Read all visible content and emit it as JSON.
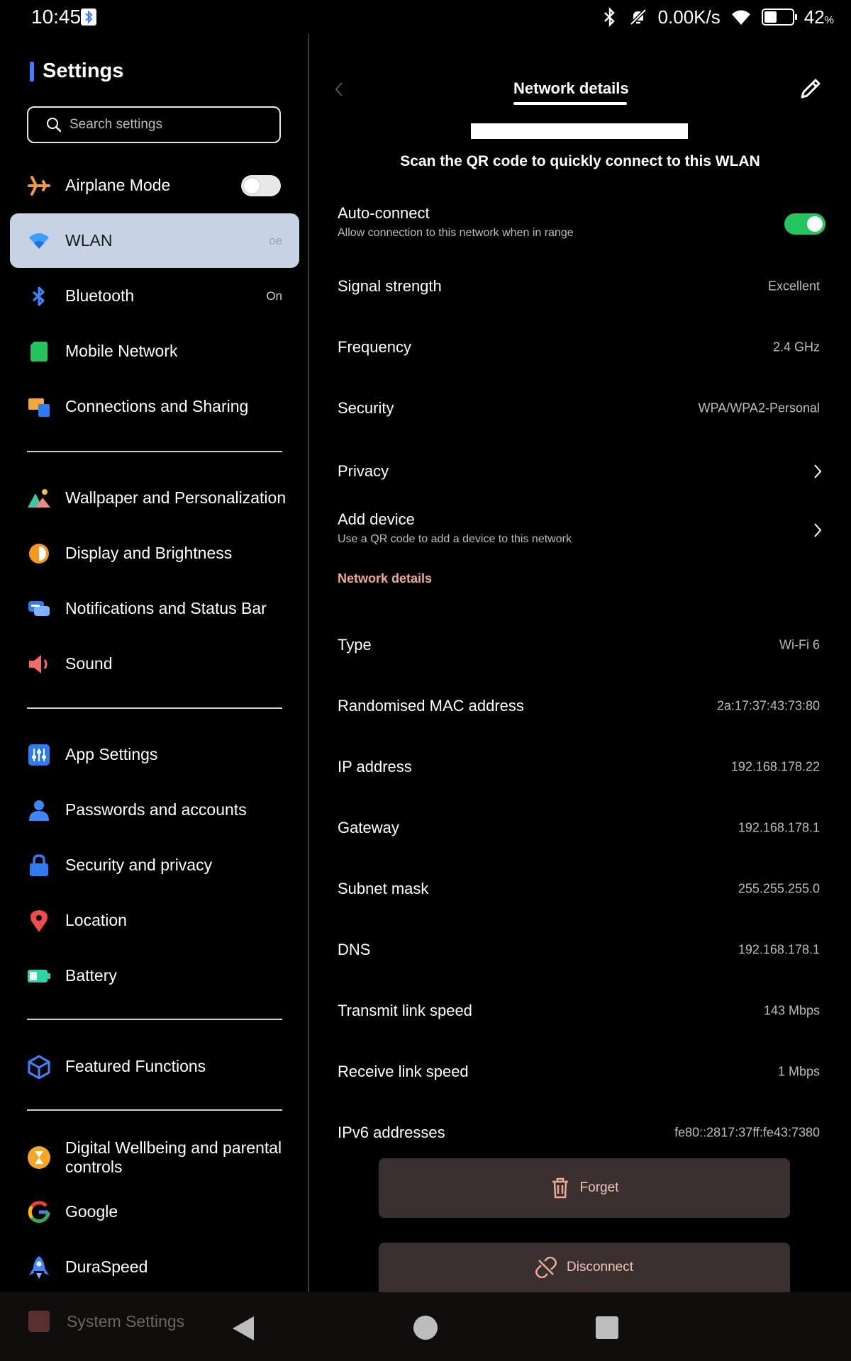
{
  "status_bar": {
    "time": "10:45",
    "speed": "0.00K/s",
    "battery_percent": "42",
    "battery_unit": "%"
  },
  "settings": {
    "title": "Settings",
    "search_placeholder": "Search settings",
    "items": [
      {
        "label": "Airplane Mode",
        "toggle": "off"
      },
      {
        "label": "WLAN",
        "value": "oe"
      },
      {
        "label": "Bluetooth",
        "value": "On"
      },
      {
        "label": "Mobile Network"
      },
      {
        "label": "Connections and Sharing"
      },
      {
        "label": "Wallpaper and Personalization"
      },
      {
        "label": "Display and Brightness"
      },
      {
        "label": "Notifications and Status Bar"
      },
      {
        "label": "Sound"
      },
      {
        "label": "App Settings"
      },
      {
        "label": "Passwords and accounts"
      },
      {
        "label": "Security and privacy"
      },
      {
        "label": "Location"
      },
      {
        "label": "Battery"
      },
      {
        "label": "Featured Functions"
      },
      {
        "label": "Digital Wellbeing and parental controls"
      },
      {
        "label": "Google"
      },
      {
        "label": "DuraSpeed"
      }
    ],
    "system_settings": "System Settings"
  },
  "details": {
    "title": "Network details",
    "qr_caption": "Scan the QR code to quickly connect to this WLAN",
    "auto_connect": {
      "label": "Auto-connect",
      "sub": "Allow connection to this network when in range",
      "state": "on"
    },
    "signal": {
      "label": "Signal strength",
      "value": "Excellent"
    },
    "frequency": {
      "label": "Frequency",
      "value": "2.4 GHz"
    },
    "security": {
      "label": "Security",
      "value": "WPA/WPA2-Personal"
    },
    "privacy": {
      "label": "Privacy"
    },
    "add_device": {
      "label": "Add device",
      "sub": "Use a QR code to add a device to this network"
    },
    "section": "Network details",
    "type": {
      "label": "Type",
      "value": "Wi-Fi 6"
    },
    "mac": {
      "label": "Randomised MAC address",
      "value": "2a:17:37:43:73:80"
    },
    "ip": {
      "label": "IP address",
      "value": "192.168.178.22"
    },
    "gateway": {
      "label": "Gateway",
      "value": "192.168.178.1"
    },
    "subnet": {
      "label": "Subnet mask",
      "value": "255.255.255.0"
    },
    "dns": {
      "label": "DNS",
      "value": "192.168.178.1"
    },
    "tx": {
      "label": "Transmit link speed",
      "value": "143 Mbps"
    },
    "rx": {
      "label": "Receive link speed",
      "value": "1 Mbps"
    },
    "ipv6": {
      "label": "IPv6 addresses",
      "value": "fe80::2817:37ff:fe43:7380"
    },
    "forget": "Forget",
    "disconnect": "Disconnect"
  },
  "colors": {
    "accent": "#3e7bff",
    "toggle_on": "#22c55e",
    "section_label": "#f0a992",
    "selected_bg": "#c7d3e4",
    "button_bg": "#3a3030"
  }
}
